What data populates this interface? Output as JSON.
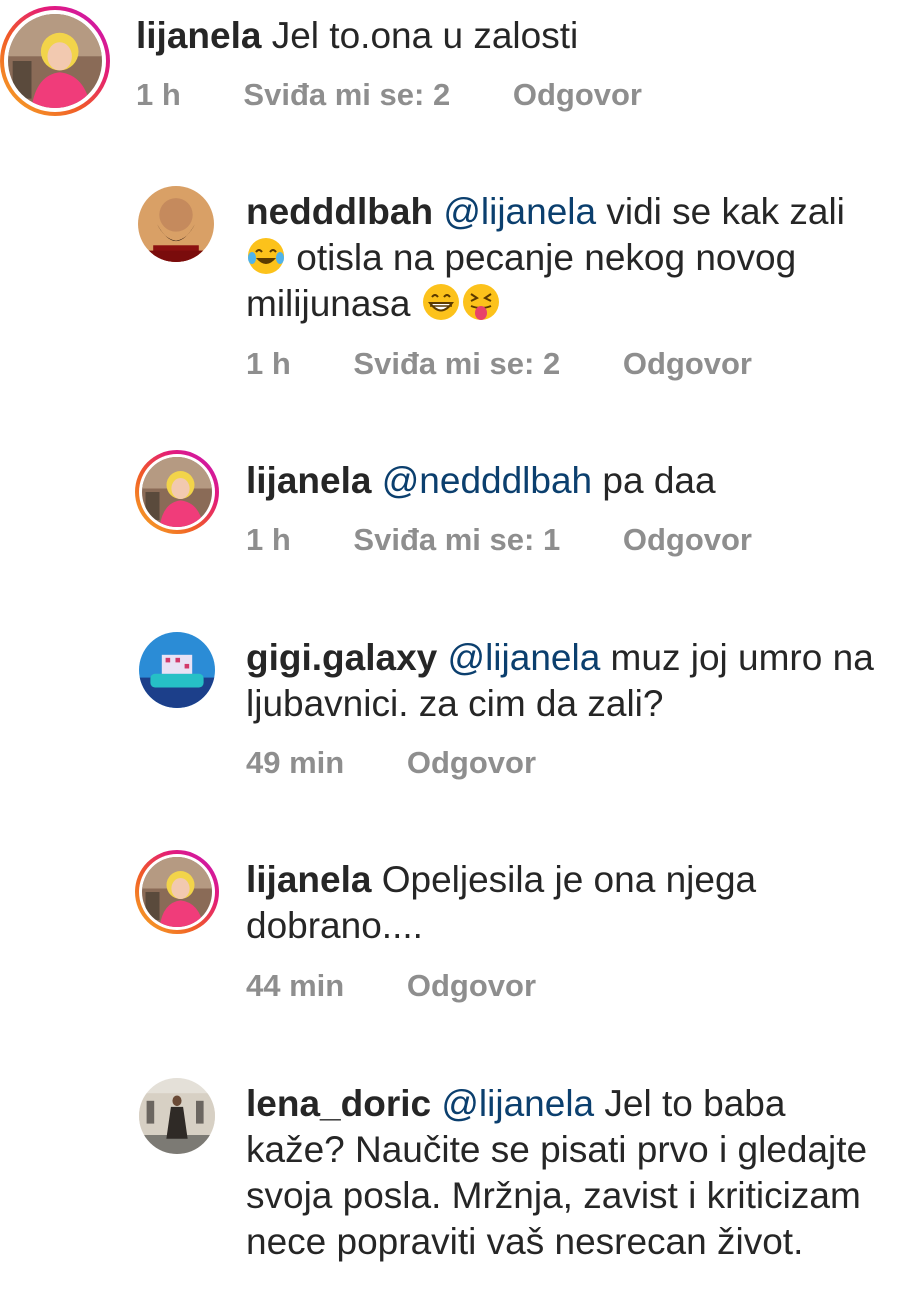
{
  "comments": [
    {
      "user": "lijanela",
      "body": " Jel to.ona u zalosti",
      "time": "1 h",
      "likes": "Sviđa mi se: 2",
      "reply": "Odgovor"
    },
    {
      "user": "nedddlbah",
      "mention": "@lijanela",
      "body_part1": "  vidi se kak zali",
      "body_part2": "  otisla na pecanje nekog novog milijunasa ",
      "time": "1 h",
      "likes": "Sviđa mi se: 2",
      "reply": "Odgovor",
      "emojis": [
        "tears-of-joy-emoji",
        "grinning-emoji",
        "tongue-out-emoji"
      ]
    },
    {
      "user": "lijanela",
      "mention": "@nedddlbah",
      "body": "  pa daa",
      "time": "1 h",
      "likes": "Sviđa mi se: 1",
      "reply": "Odgovor"
    },
    {
      "user": "gigi.galaxy",
      "mention": "@lijanela",
      "body": " muz joj umro na ljubavnici. za cim da zali?",
      "time": "49 min",
      "reply": "Odgovor"
    },
    {
      "user": "lijanela",
      "body": " Opeljesila je ona njega dobrano....",
      "time": "44 min",
      "reply": "Odgovor"
    },
    {
      "user": "lena_doric",
      "mention": "@lijanela",
      "body": " Jel to baba kaže? Naučite se pisati prvo i gledajte svoja posla. Mržnja, zavist i kriticizam nece popraviti vaš nesrecan život."
    }
  ],
  "colors": {
    "text": "#262626",
    "meta": "#8e8e8e",
    "mention": "#0b3f6e"
  }
}
